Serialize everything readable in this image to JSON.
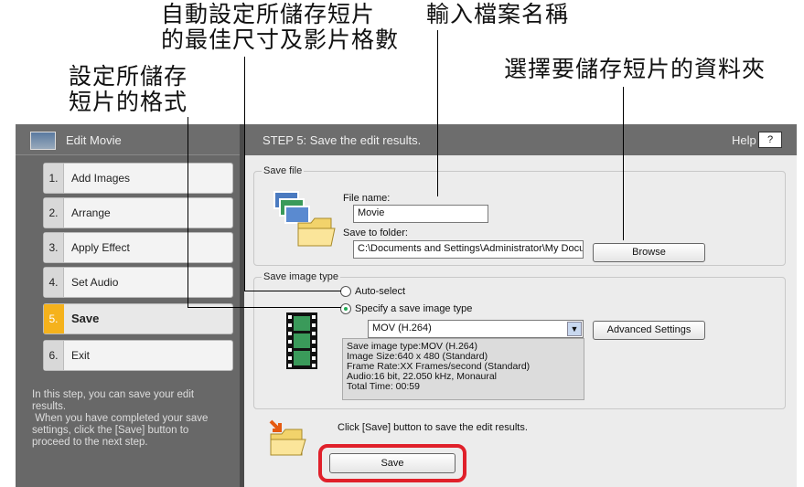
{
  "annotations": {
    "auto_size": [
      "自動設定所儲存短片",
      "的最佳尺寸及影片格數"
    ],
    "filename": "輸入檔案名稱",
    "folder": "選擇要儲存短片的資料夾",
    "format": [
      "設定所儲存",
      "短片的格式"
    ]
  },
  "left_panel": {
    "title": "Edit Movie",
    "steps": [
      {
        "num": "1.",
        "label": "Add Images"
      },
      {
        "num": "2.",
        "label": "Arrange"
      },
      {
        "num": "3.",
        "label": "Apply Effect"
      },
      {
        "num": "4.",
        "label": "Set Audio"
      },
      {
        "num": "5.",
        "label": "Save"
      },
      {
        "num": "6.",
        "label": "Exit"
      }
    ],
    "description": "In this step, you can save your edit results.\n When you have completed your save settings, click the [Save] button to proceed to the next step."
  },
  "right_panel": {
    "title": "STEP 5: Save the edit results.",
    "help_label": "Help",
    "help_button": "?",
    "save_file": {
      "group_title": "Save file",
      "file_name_label": "File name:",
      "file_name_value": "Movie",
      "folder_label": "Save to folder:",
      "folder_value": "C:\\Documents and Settings\\Administrator\\My Docu",
      "browse_label": "Browse"
    },
    "save_image_type": {
      "group_title": "Save image type",
      "auto_select": "Auto-select",
      "specify": "Specify a save image type",
      "selected_format": "MOV (H.264)",
      "advanced_label": "Advanced Settings",
      "info": [
        "Save image type:MOV (H.264)",
        "Image Size:640 x 480 (Standard)",
        "Frame Rate:XX Frames/second (Standard)",
        "Audio:16 bit, 22.050 kHz, Monaural",
        "Total Time: 00:59"
      ]
    },
    "save_hint": "Click [Save] button to save the edit results.",
    "save_button": "Save"
  },
  "colors": {
    "active_step": "#f5b21c",
    "highlight": "#e0202a"
  }
}
